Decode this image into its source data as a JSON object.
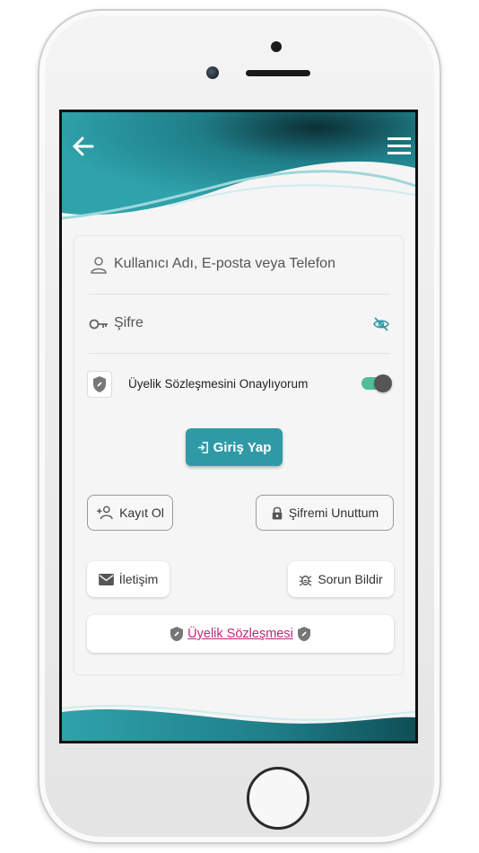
{
  "colors": {
    "teal": "#2f9aa6",
    "toggle_on": "#4fbf9a",
    "link": "#c0277a"
  },
  "header": {
    "back_icon": "arrow-left-icon",
    "menu_icon": "hamburger-menu-icon"
  },
  "form": {
    "username_placeholder": "Kullanıcı Adı, E-posta veya Telefon",
    "password_placeholder": "Şifre",
    "consent_label": "Üyelik Sözleşmesini Onaylıyorum",
    "consent_checked": true,
    "login_label": "Giriş Yap"
  },
  "actions": {
    "register_label": "Kayıt Ol",
    "forgot_label": "Şifremi Unuttum",
    "contact_label": "İletişim",
    "report_label": "Sorun Bildir",
    "agreement_label": "Üyelik Sözleşmesi"
  }
}
